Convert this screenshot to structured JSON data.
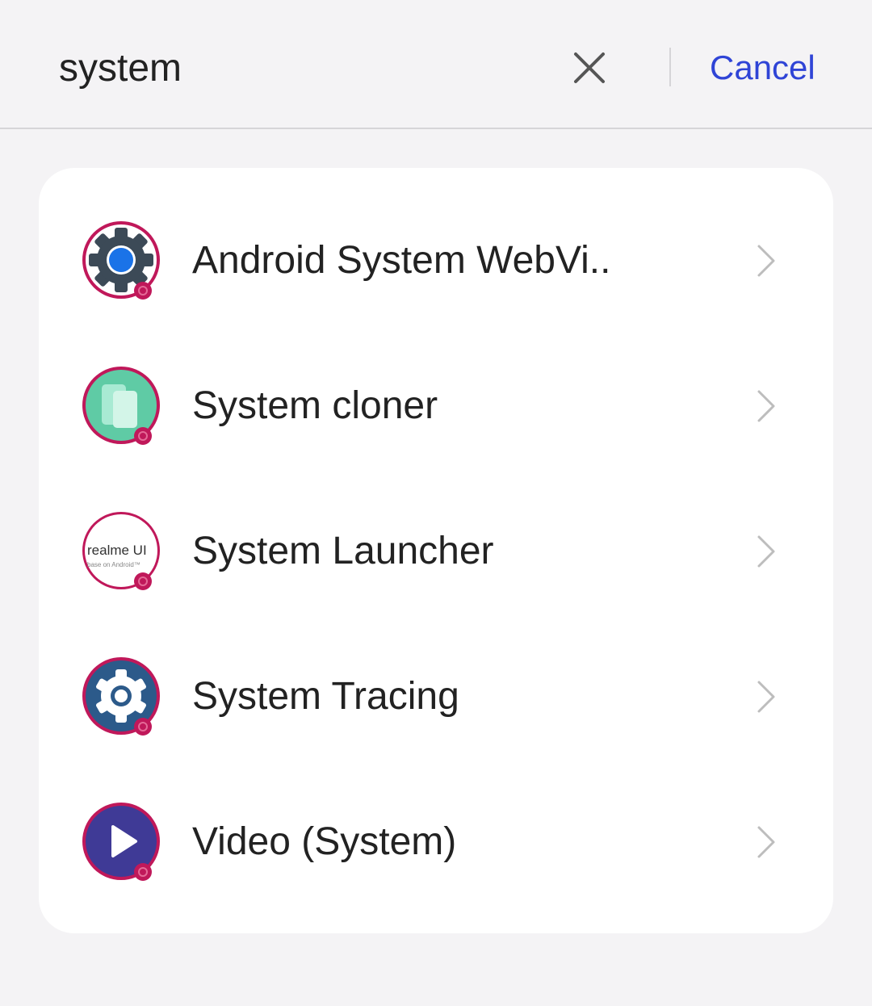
{
  "search": {
    "value": "system",
    "cancel_label": "Cancel"
  },
  "results": [
    {
      "label": "Android System WebVi..",
      "icon": "webview-gear-icon"
    },
    {
      "label": "System cloner",
      "icon": "cloner-icon"
    },
    {
      "label": "System Launcher",
      "icon": "realme-ui-icon",
      "icon_text": "realme UI",
      "icon_subtext": "base on Android™"
    },
    {
      "label": "System Tracing",
      "icon": "tracing-gear-icon"
    },
    {
      "label": "Video (System)",
      "icon": "video-play-icon"
    }
  ],
  "colors": {
    "accent": "#2f44d6",
    "background": "#f4f3f5",
    "card": "#ffffff",
    "icon_ring": "#c0185a"
  }
}
